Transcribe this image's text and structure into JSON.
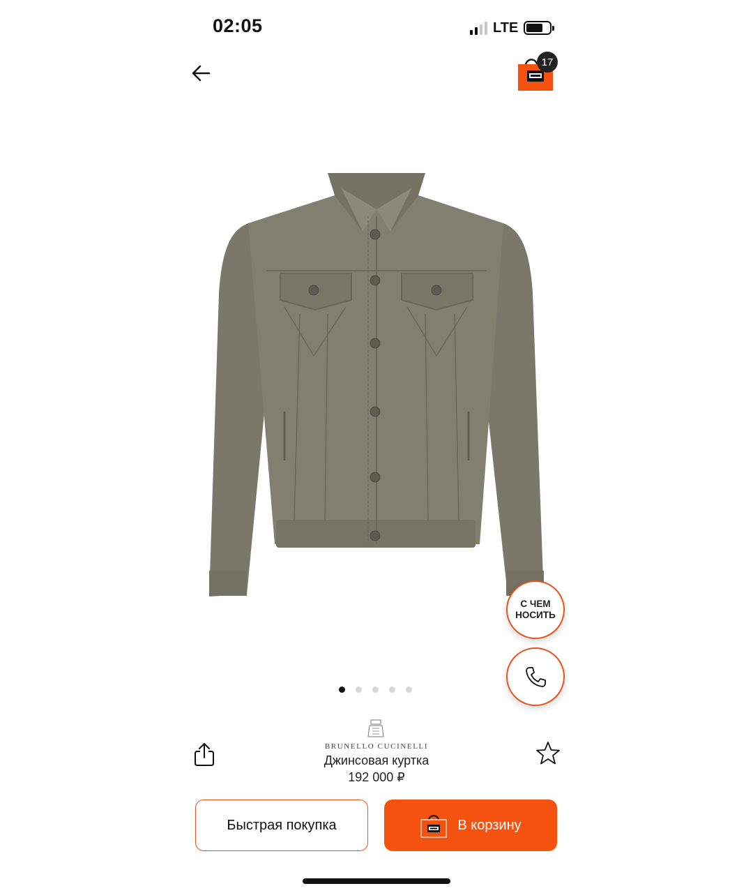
{
  "status_bar": {
    "time": "02:05",
    "network": "LTE",
    "signal_bars_active": 2,
    "battery_level": 0.7
  },
  "nav": {
    "cart_count": "17"
  },
  "gallery": {
    "image_count": 5,
    "active_index": 0
  },
  "floating": {
    "wear_label_line1": "С ЧЕМ",
    "wear_label_line2": "НОСИТЬ"
  },
  "product": {
    "brand": "BRUNELLO CUCINELLI",
    "title": "Джинсовая куртка",
    "price": "192 000 ₽"
  },
  "actions": {
    "quick_buy": "Быстрая покупка",
    "add_to_cart": "В корзину"
  },
  "colors": {
    "accent": "#f5520f",
    "jacket": "#7e7c6d"
  },
  "icons": {
    "back": "arrow-left-icon",
    "cart": "shopping-bag-icon",
    "call": "phone-icon",
    "share": "share-icon",
    "favorite": "star-icon"
  }
}
